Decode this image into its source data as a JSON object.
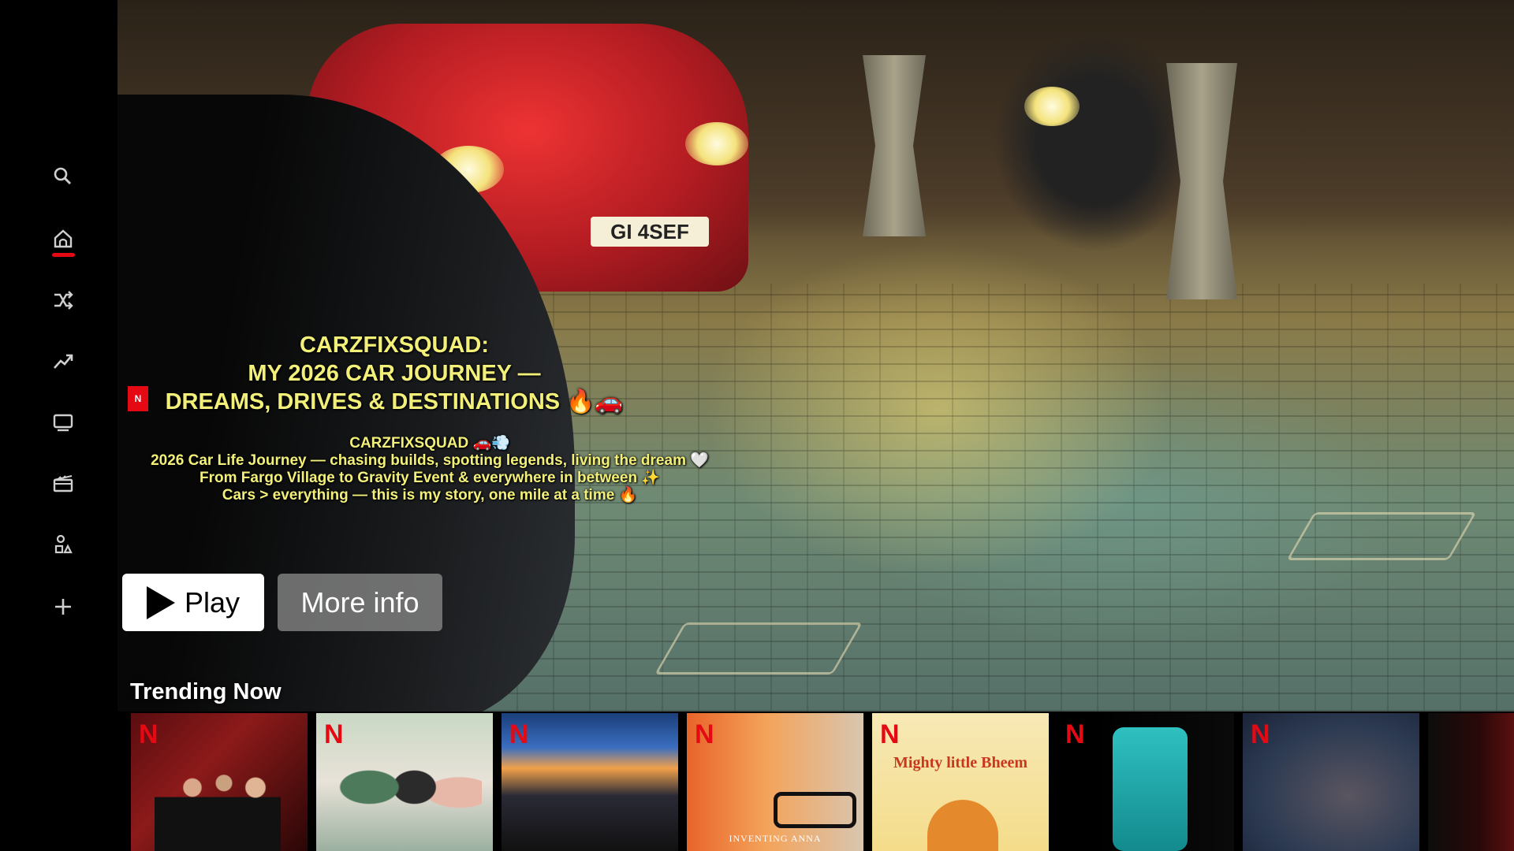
{
  "sidebar": {
    "items": [
      {
        "name": "search",
        "icon": "search-icon"
      },
      {
        "name": "home",
        "icon": "home-icon",
        "active": true
      },
      {
        "name": "shuffle",
        "icon": "shuffle-icon"
      },
      {
        "name": "trending",
        "icon": "trending-icon"
      },
      {
        "name": "tv-shows",
        "icon": "tv-icon"
      },
      {
        "name": "movies",
        "icon": "film-icon"
      },
      {
        "name": "categories",
        "icon": "categories-icon"
      },
      {
        "name": "my-list",
        "icon": "plus-icon"
      }
    ],
    "accent_color": "#e50914"
  },
  "hero": {
    "background_plate": "GI 4SEF",
    "title_line1": "CARZFIXSQUAD:",
    "title_line2": "MY 2026 CAR JOURNEY —",
    "title_line3": "DREAMS, DRIVES & DESTINATIONS 🔥🚗",
    "badge_text": "N",
    "desc_line1": "CARZFIXSQUAD 🚗💨",
    "desc_line2": "2026 Car Life Journey — chasing builds, spotting legends, living the dream 🤍",
    "desc_line3": "From Fargo Village to Gravity Event & everywhere in between ✨",
    "desc_line4": "Cars > everything — this is my story, one mile at a time 🔥",
    "text_color": "#f3f07a"
  },
  "buttons": {
    "play_label": "Play",
    "more_info_label": "More info"
  },
  "trending": {
    "title": "Trending Now",
    "tiles": [
      {
        "logo": "N",
        "caption": ""
      },
      {
        "logo": "N",
        "caption": ""
      },
      {
        "logo": "N",
        "caption": ""
      },
      {
        "logo": "N",
        "caption": "INVENTING ANNA"
      },
      {
        "logo": "N",
        "caption": "Mighty little Bheem"
      },
      {
        "logo": "N",
        "caption": ""
      },
      {
        "logo": "N",
        "caption": ""
      }
    ]
  }
}
